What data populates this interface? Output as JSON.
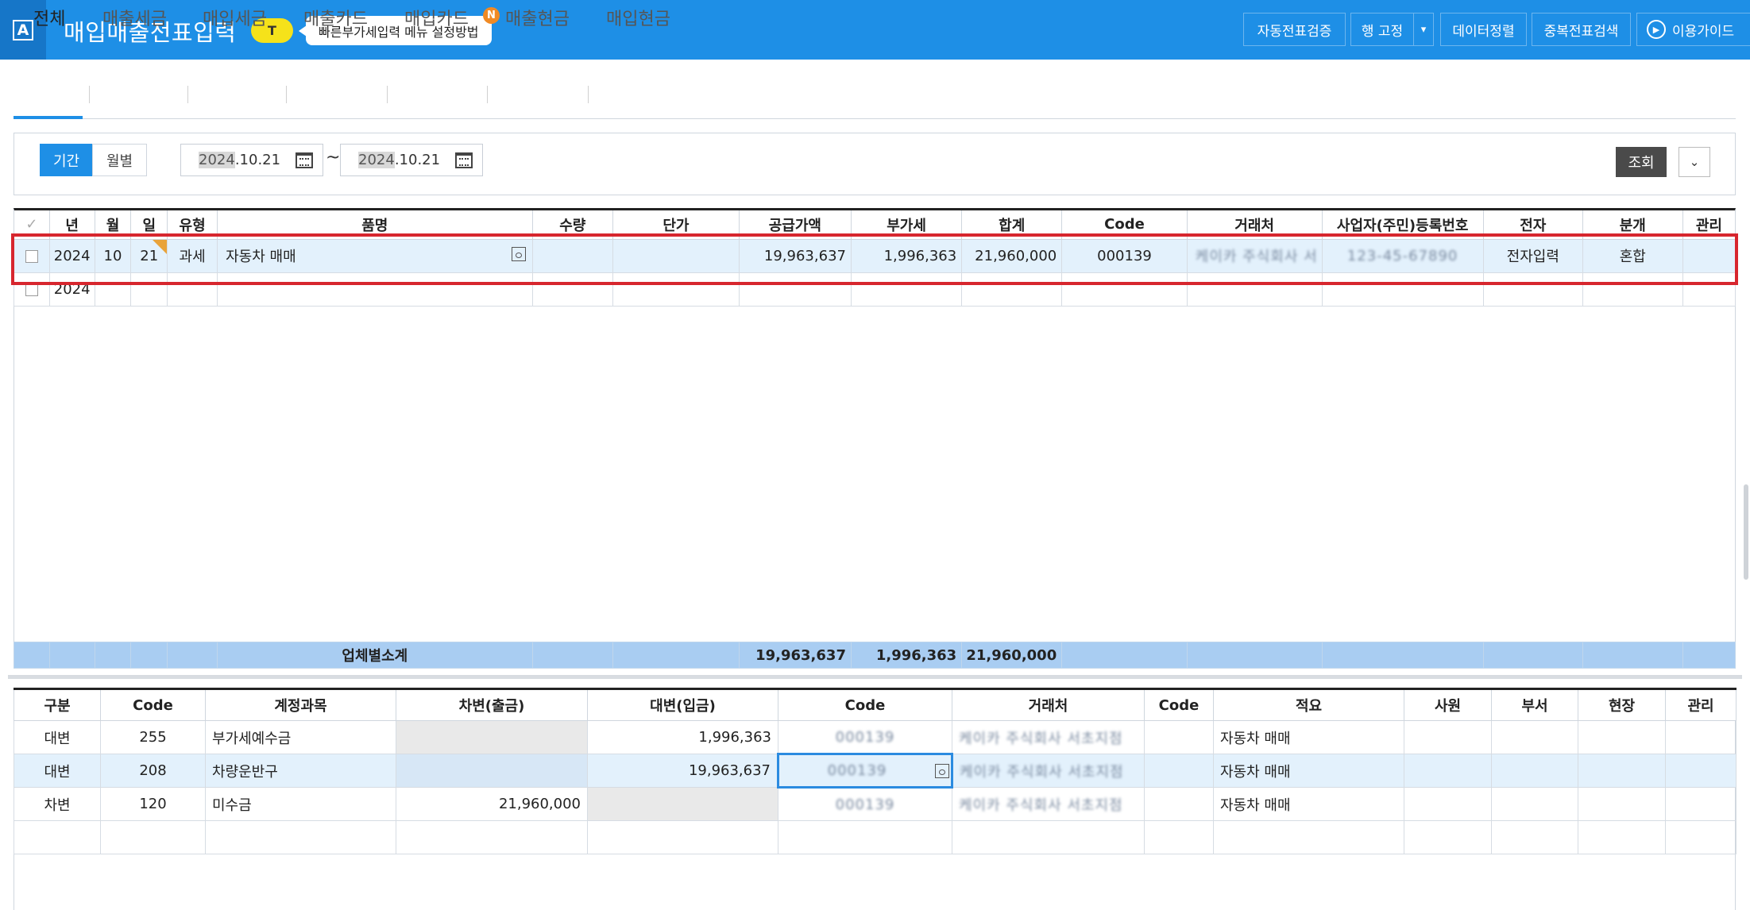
{
  "header": {
    "title": "매입매출전표입력",
    "t_badge": "T",
    "tip_text": "빠른부가세입력 메뉴 설정방법",
    "new_badge": "N",
    "buttons": {
      "auto_verify": "자동전표검증",
      "row_fix": "행 고정",
      "sort_data": "데이터정렬",
      "dup_search": "중복전표검색",
      "guide": "이용가이드"
    },
    "brand_color": "#1e8fe6"
  },
  "tabs": [
    "전체",
    "매출세금",
    "매입세금",
    "매출카드",
    "매입카드",
    "매출현금",
    "매입현금"
  ],
  "active_tab": "전체",
  "filter": {
    "period_label": "기간",
    "monthly_label": "월별",
    "date_from_year": "2024",
    "date_from_rest": ".10.21",
    "date_to_year": "2024",
    "date_to_rest": ".10.21",
    "range_sep": "~",
    "search_label": "조회"
  },
  "upper_grid": {
    "check_header": "✓",
    "columns": [
      "년",
      "월",
      "일",
      "유형",
      "품명",
      "수량",
      "단가",
      "공급가액",
      "부가세",
      "합계",
      "Code",
      "거래처",
      "사업자(주민)등록번호",
      "전자",
      "분개",
      "관리"
    ],
    "rows": [
      {
        "year": "2024",
        "month": "10",
        "day": "21",
        "type": "과세",
        "item": "자동차 매매",
        "qty": "",
        "unit_price": "",
        "supply": "19,963,637",
        "vat": "1,996,363",
        "total": "21,960,000",
        "code": "000139",
        "vendor": "케이카 주식회사 서",
        "reg_no": "123-45-67890",
        "electronic": "전자입력",
        "journal": "혼합",
        "manage": ""
      },
      {
        "year": "2024",
        "month": "",
        "day": "",
        "type": "",
        "item": "",
        "qty": "",
        "unit_price": "",
        "supply": "",
        "vat": "",
        "total": "",
        "code": "",
        "vendor": "",
        "reg_no": "",
        "electronic": "",
        "journal": "",
        "manage": ""
      }
    ],
    "subtotal": {
      "label": "업체별소계",
      "supply": "19,963,637",
      "vat": "1,996,363",
      "total": "21,960,000"
    }
  },
  "lower_grid": {
    "columns": [
      "구분",
      "Code",
      "계정과목",
      "차변(출금)",
      "대변(입금)",
      "Code",
      "거래처",
      "Code",
      "적요",
      "사원",
      "부서",
      "현장",
      "관리"
    ],
    "rows": [
      {
        "div": "대변",
        "code": "255",
        "account": "부가세예수금",
        "debit": "",
        "credit": "1,996,363",
        "vcode": "000139",
        "vendor": "케이카 주식회사 서초지점",
        "code2": "",
        "memo": "자동차 매매"
      },
      {
        "div": "대변",
        "code": "208",
        "account": "차량운반구",
        "debit": "",
        "credit": "19,963,637",
        "vcode": "000139",
        "vendor": "케이카 주식회사 서초지점",
        "code2": "",
        "memo": "자동차 매매"
      },
      {
        "div": "차변",
        "code": "120",
        "account": "미수금",
        "debit": "21,960,000",
        "credit": "",
        "vcode": "000139",
        "vendor": "케이카 주식회사 서초지점",
        "code2": "",
        "memo": "자동차 매매"
      }
    ]
  }
}
